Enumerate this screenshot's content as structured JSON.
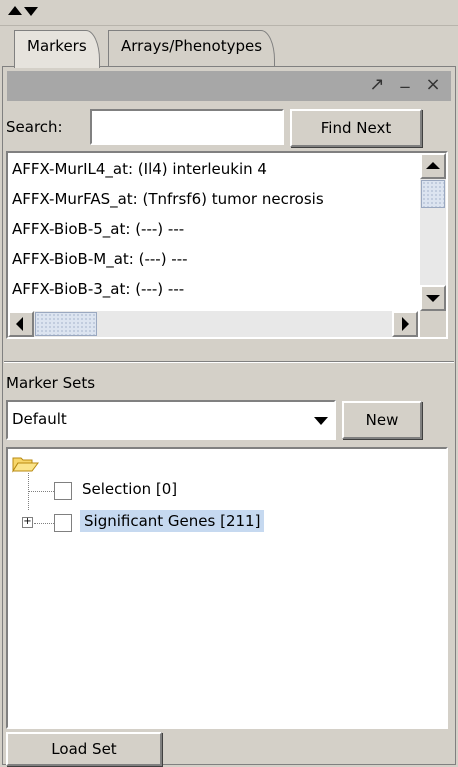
{
  "tabs": [
    {
      "label": "Markers",
      "active": true
    },
    {
      "label": "Arrays/Phenotypes",
      "active": false
    }
  ],
  "titlebar": {
    "buttons": [
      {
        "icon": "maximize-arrow-icon",
        "glyph": "↗"
      },
      {
        "icon": "minimize-icon",
        "glyph": "_"
      },
      {
        "icon": "close-icon",
        "glyph": "×"
      }
    ]
  },
  "search": {
    "label": "Search:",
    "value": "",
    "placeholder": "",
    "find_next_label": "Find Next"
  },
  "markers": [
    "AFFX-MurIL4_at: (Il4) interleukin 4",
    "AFFX-MurFAS_at: (Tnfrsf6) tumor necrosis",
    "AFFX-BioB-5_at: (---) ---",
    "AFFX-BioB-M_at: (---) ---",
    "AFFX-BioB-3_at: (---) ---"
  ],
  "marker_sets": {
    "label": "Marker Sets",
    "selected": "Default",
    "new_label": "New",
    "tree": [
      {
        "label": "Selection [0]",
        "checked": false,
        "expandable": false,
        "highlighted": false
      },
      {
        "label": "Significant Genes [211]",
        "checked": false,
        "expandable": true,
        "highlighted": true
      }
    ],
    "highlight_color": "#c6d9f0"
  },
  "load_set_label": "Load Set"
}
